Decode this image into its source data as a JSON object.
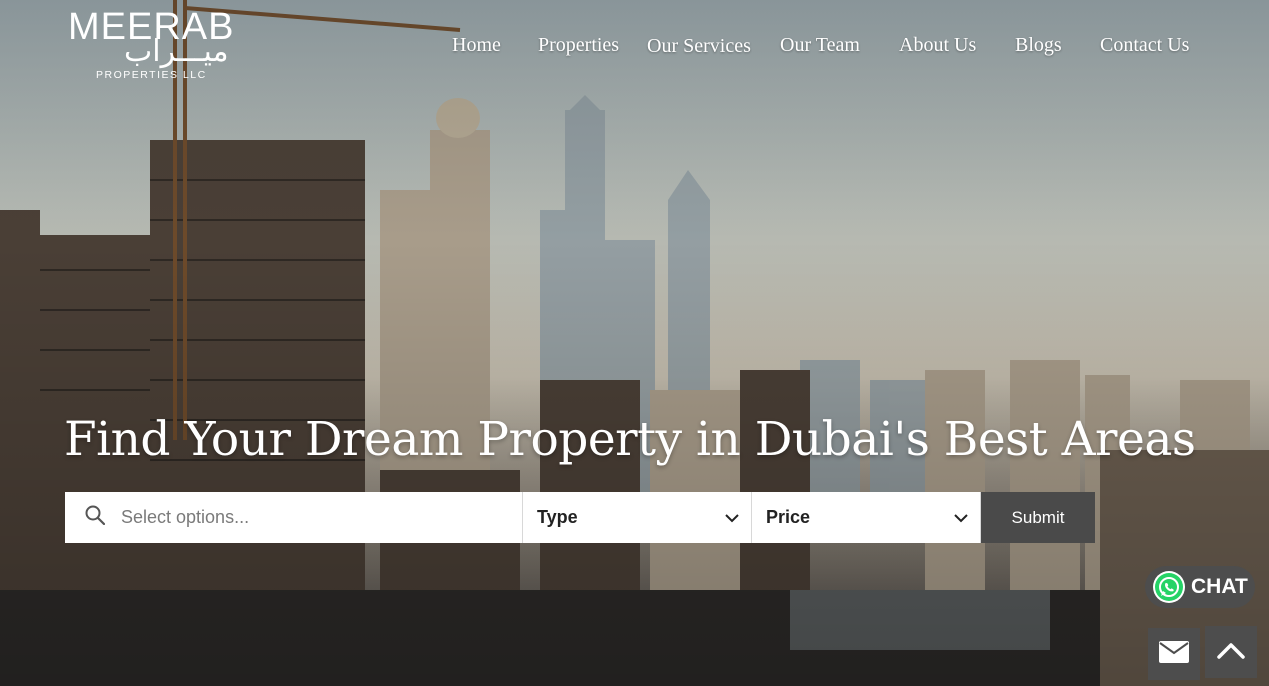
{
  "brand": {
    "name": "MEERAB",
    "arabic": "ميـــراب",
    "subtitle": "PROPERTIES LLC"
  },
  "nav": {
    "items": [
      {
        "label": "Home"
      },
      {
        "label": "Properties"
      },
      {
        "label": "Our Services"
      },
      {
        "label": "Our Team"
      },
      {
        "label": "About Us"
      },
      {
        "label": "Blogs"
      },
      {
        "label": "Contact Us"
      }
    ]
  },
  "hero": {
    "headline": "Find Your Dream Property in Dubai's Best Areas"
  },
  "search": {
    "placeholder": "Select options...",
    "type_label": "Type",
    "price_label": "Price",
    "submit_label": "Submit"
  },
  "widgets": {
    "chat_label": "CHAT"
  },
  "colors": {
    "button_bg": "#4a4a4a",
    "whatsapp_green": "#25d366"
  }
}
